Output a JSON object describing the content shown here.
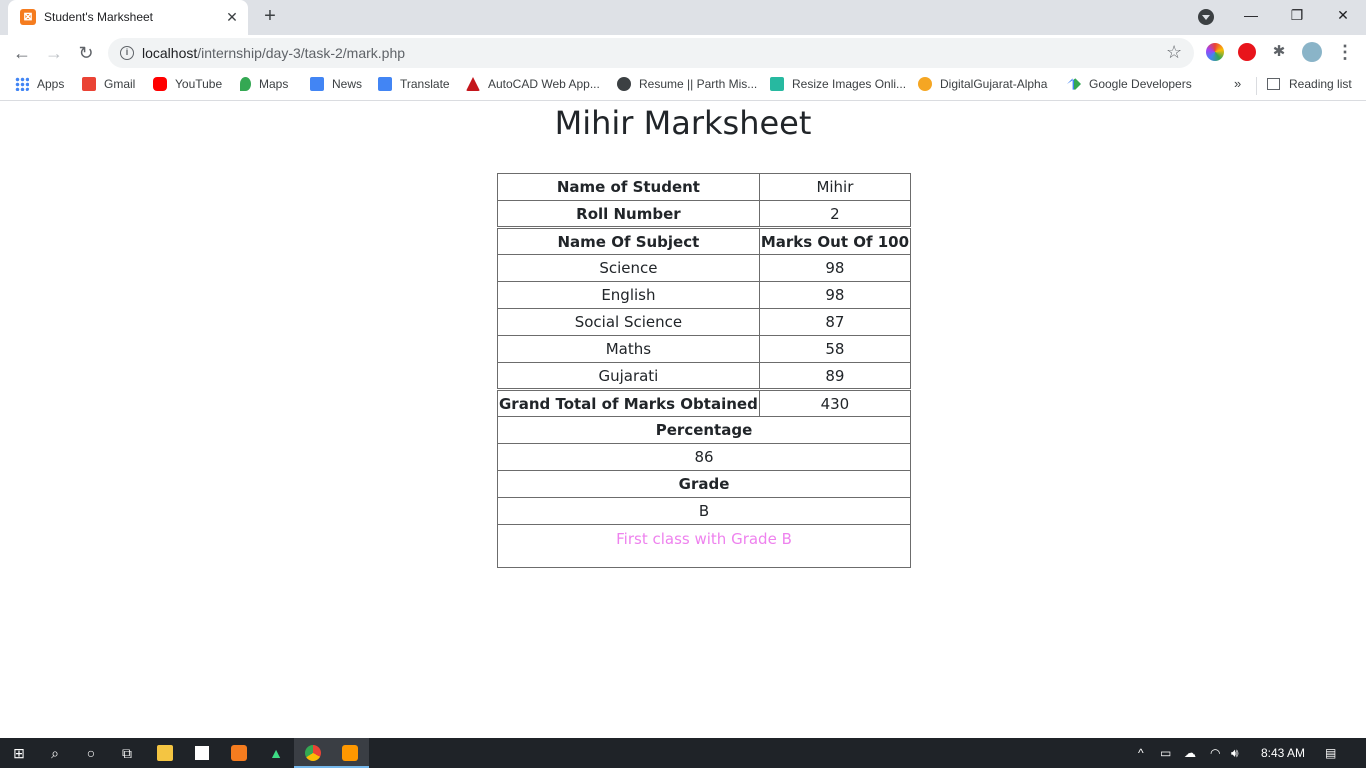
{
  "browser": {
    "tab_title": "Student's Marksheet",
    "tab_close": "✕",
    "new_tab": "+",
    "window_minimize": "—",
    "window_restore": "❐",
    "window_close": "✕",
    "url_host": "localhost",
    "url_path": "/internship/day-3/task-2/mark.php",
    "bookmarks": [
      {
        "label": "Apps",
        "icon": "apps-grid-icon",
        "color": "#4285f4"
      },
      {
        "label": "Gmail",
        "icon": "gmail-icon",
        "color": "#ea4335"
      },
      {
        "label": "YouTube",
        "icon": "youtube-icon",
        "color": "#ff0000"
      },
      {
        "label": "Maps",
        "icon": "maps-pin-icon",
        "color": "#34a853"
      },
      {
        "label": "News",
        "icon": "news-icon",
        "color": "#4285f4"
      },
      {
        "label": "Translate",
        "icon": "translate-icon",
        "color": "#4285f4"
      },
      {
        "label": "AutoCAD Web App...",
        "icon": "autocad-icon",
        "color": "#c4161c"
      },
      {
        "label": "Resume || Parth Mis...",
        "icon": "globe-icon",
        "color": "#3c4043"
      },
      {
        "label": "Resize Images Onli...",
        "icon": "resize-icon",
        "color": "#27b9a0"
      },
      {
        "label": "DigitalGujarat-Alpha",
        "icon": "digitalgujarat-icon",
        "color": "#f5a623"
      },
      {
        "label": "Google Developers",
        "icon": "google-developers-icon",
        "color": "#4285f4"
      }
    ],
    "bookmarks_more": "»",
    "reading_list": "Reading list"
  },
  "page": {
    "title": "Mihir Marksheet",
    "student_name_label": "Name of Student",
    "student_name": "Mihir",
    "roll_label": "Roll Number",
    "roll_number": "2",
    "subject_header": "Name Of Subject",
    "marks_header": "Marks Out Of 100",
    "subjects": [
      {
        "name": "Science",
        "marks": "98"
      },
      {
        "name": "English",
        "marks": "98"
      },
      {
        "name": "Social Science",
        "marks": "87"
      },
      {
        "name": "Maths",
        "marks": "58"
      },
      {
        "name": "Gujarati",
        "marks": "89"
      }
    ],
    "total_label": "Grand Total of Marks Obtained",
    "total": "430",
    "percentage_label": "Percentage",
    "percentage": "86",
    "grade_label": "Grade",
    "grade": "B",
    "remark": "First class with Grade B",
    "remark_color": "#ee82ee"
  },
  "taskbar": {
    "time": "8:43 AM"
  }
}
